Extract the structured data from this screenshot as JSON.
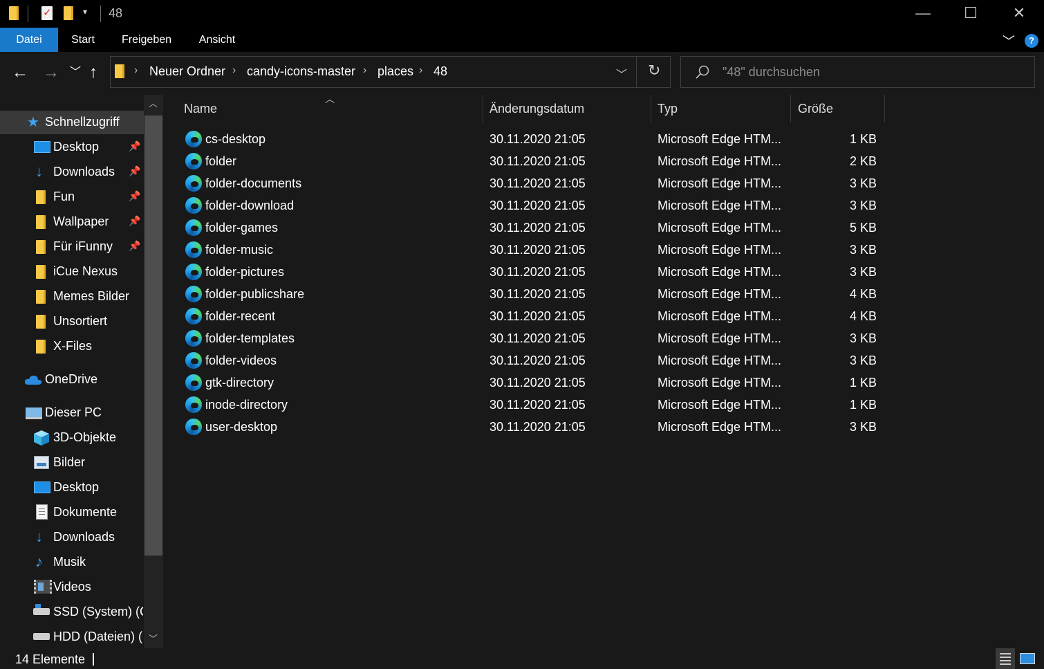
{
  "window": {
    "title": "48",
    "controls": {
      "minimize": "—",
      "maximize": "☐",
      "close": "✕"
    }
  },
  "ribbon": {
    "tabs": [
      "Datei",
      "Start",
      "Freigeben",
      "Ansicht"
    ],
    "help": "?",
    "accent_color": "#1979ca"
  },
  "address": {
    "breadcrumbs": [
      "Neuer Ordner",
      "candy-icons-master",
      "places",
      "48"
    ]
  },
  "search": {
    "placeholder": "\"48\" durchsuchen"
  },
  "sidebar": {
    "quick_access": {
      "label": "Schnellzugriff",
      "items": [
        {
          "label": "Desktop",
          "icon": "desktop-icon",
          "pinned": true
        },
        {
          "label": "Downloads",
          "icon": "download-icon",
          "pinned": true
        },
        {
          "label": "Fun",
          "icon": "folder-icon",
          "pinned": true
        },
        {
          "label": "Wallpaper",
          "icon": "folder-icon",
          "pinned": true
        },
        {
          "label": "Für iFunny",
          "icon": "folder-icon",
          "pinned": true
        },
        {
          "label": "iCue Nexus",
          "icon": "folder-icon",
          "pinned": false
        },
        {
          "label": "Memes Bilder",
          "icon": "folder-icon",
          "pinned": false
        },
        {
          "label": "Unsortiert",
          "icon": "folder-icon",
          "pinned": false
        },
        {
          "label": "X-Files",
          "icon": "folder-icon",
          "pinned": false
        }
      ]
    },
    "onedrive": {
      "label": "OneDrive"
    },
    "this_pc": {
      "label": "Dieser PC",
      "items": [
        {
          "label": "3D-Objekte",
          "icon": "cube-icon"
        },
        {
          "label": "Bilder",
          "icon": "pictures-icon"
        },
        {
          "label": "Desktop",
          "icon": "desktop-icon"
        },
        {
          "label": "Dokumente",
          "icon": "document-icon"
        },
        {
          "label": "Downloads",
          "icon": "download-icon"
        },
        {
          "label": "Musik",
          "icon": "music-icon"
        },
        {
          "label": "Videos",
          "icon": "video-icon"
        },
        {
          "label": "SSD (System) (C:",
          "icon": "drive-icon"
        },
        {
          "label": "HDD (Dateien) (D",
          "icon": "drive-icon"
        }
      ]
    }
  },
  "filelist": {
    "columns": {
      "name": "Name",
      "date": "Änderungsdatum",
      "type": "Typ",
      "size": "Größe"
    },
    "files": [
      {
        "name": "cs-desktop",
        "date": "30.11.2020 21:05",
        "type": "Microsoft Edge HTM...",
        "size": "1 KB"
      },
      {
        "name": "folder",
        "date": "30.11.2020 21:05",
        "type": "Microsoft Edge HTM...",
        "size": "2 KB"
      },
      {
        "name": "folder-documents",
        "date": "30.11.2020 21:05",
        "type": "Microsoft Edge HTM...",
        "size": "3 KB"
      },
      {
        "name": "folder-download",
        "date": "30.11.2020 21:05",
        "type": "Microsoft Edge HTM...",
        "size": "3 KB"
      },
      {
        "name": "folder-games",
        "date": "30.11.2020 21:05",
        "type": "Microsoft Edge HTM...",
        "size": "5 KB"
      },
      {
        "name": "folder-music",
        "date": "30.11.2020 21:05",
        "type": "Microsoft Edge HTM...",
        "size": "3 KB"
      },
      {
        "name": "folder-pictures",
        "date": "30.11.2020 21:05",
        "type": "Microsoft Edge HTM...",
        "size": "3 KB"
      },
      {
        "name": "folder-publicshare",
        "date": "30.11.2020 21:05",
        "type": "Microsoft Edge HTM...",
        "size": "4 KB"
      },
      {
        "name": "folder-recent",
        "date": "30.11.2020 21:05",
        "type": "Microsoft Edge HTM...",
        "size": "4 KB"
      },
      {
        "name": "folder-templates",
        "date": "30.11.2020 21:05",
        "type": "Microsoft Edge HTM...",
        "size": "3 KB"
      },
      {
        "name": "folder-videos",
        "date": "30.11.2020 21:05",
        "type": "Microsoft Edge HTM...",
        "size": "3 KB"
      },
      {
        "name": "gtk-directory",
        "date": "30.11.2020 21:05",
        "type": "Microsoft Edge HTM...",
        "size": "1 KB"
      },
      {
        "name": "inode-directory",
        "date": "30.11.2020 21:05",
        "type": "Microsoft Edge HTM...",
        "size": "1 KB"
      },
      {
        "name": "user-desktop",
        "date": "30.11.2020 21:05",
        "type": "Microsoft Edge HTM...",
        "size": "3 KB"
      }
    ]
  },
  "status": {
    "count": "14 Elemente"
  }
}
